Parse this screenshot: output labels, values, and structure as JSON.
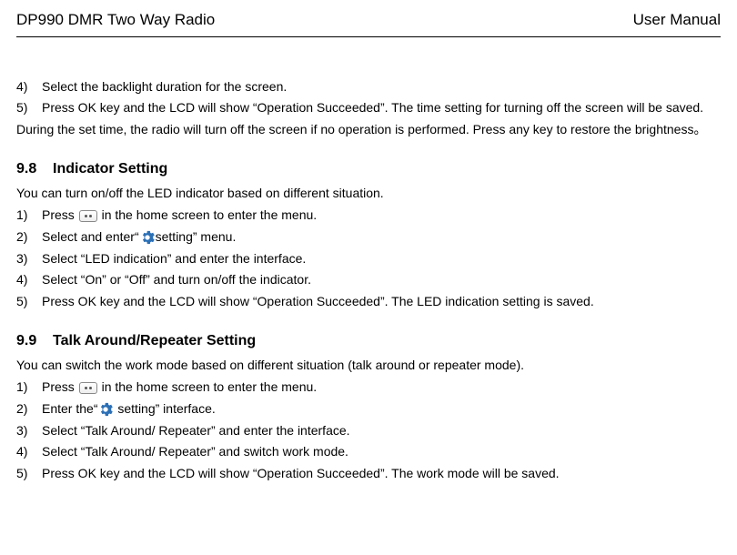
{
  "header": {
    "left": "DP990 DMR Two Way Radio",
    "right": "User Manual"
  },
  "top_block": {
    "item4_num": "4)",
    "item4_text": "Select the backlight duration for the screen.",
    "item5_num": "5)",
    "item5_text": "Press OK key and the LCD will show “Operation Succeeded”. The time setting for turning off the screen will be saved.",
    "para_after": "During the set time, the radio will turn off the screen if no operation is performed. Press any key to restore the brightness。"
  },
  "section98": {
    "heading_num": "9.8",
    "heading_title": "Indicator Setting",
    "intro": "You can turn on/off the LED indicator based on different situation.",
    "i1_num": "1)",
    "i1_a": "Press",
    "i1_b": "in the home screen to enter the menu.",
    "i2_num": "2)",
    "i2_a": "Select and enter“",
    "i2_b": "setting” menu.",
    "i3_num": "3)",
    "i3_text": "Select “LED indication” and enter the interface.",
    "i4_num": "4)",
    "i4_text": "Select “On” or “Off” and turn on/off the indicator.",
    "i5_num": "5)",
    "i5_text": "Press OK key and the LCD will show “Operation Succeeded”. The LED indication setting is saved."
  },
  "section99": {
    "heading_num": "9.9",
    "heading_title": "Talk Around/Repeater Setting",
    "intro": "You can switch the work mode based on different situation (talk around or repeater mode).",
    "i1_num": "1)",
    "i1_a": "Press",
    "i1_b": "in the home screen to enter the menu.",
    "i2_num": "2)",
    "i2_a": "Enter the“",
    "i2_b": " setting” interface.",
    "i3_num": "3)",
    "i3_text": "Select “Talk Around/ Repeater” and enter the interface.",
    "i4_num": "4)",
    "i4_text": "Select “Talk Around/ Repeater” and switch work mode.",
    "i5_num": "5)",
    "i5_text": "Press OK key and the LCD will show “Operation Succeeded”. The work mode will be saved."
  }
}
